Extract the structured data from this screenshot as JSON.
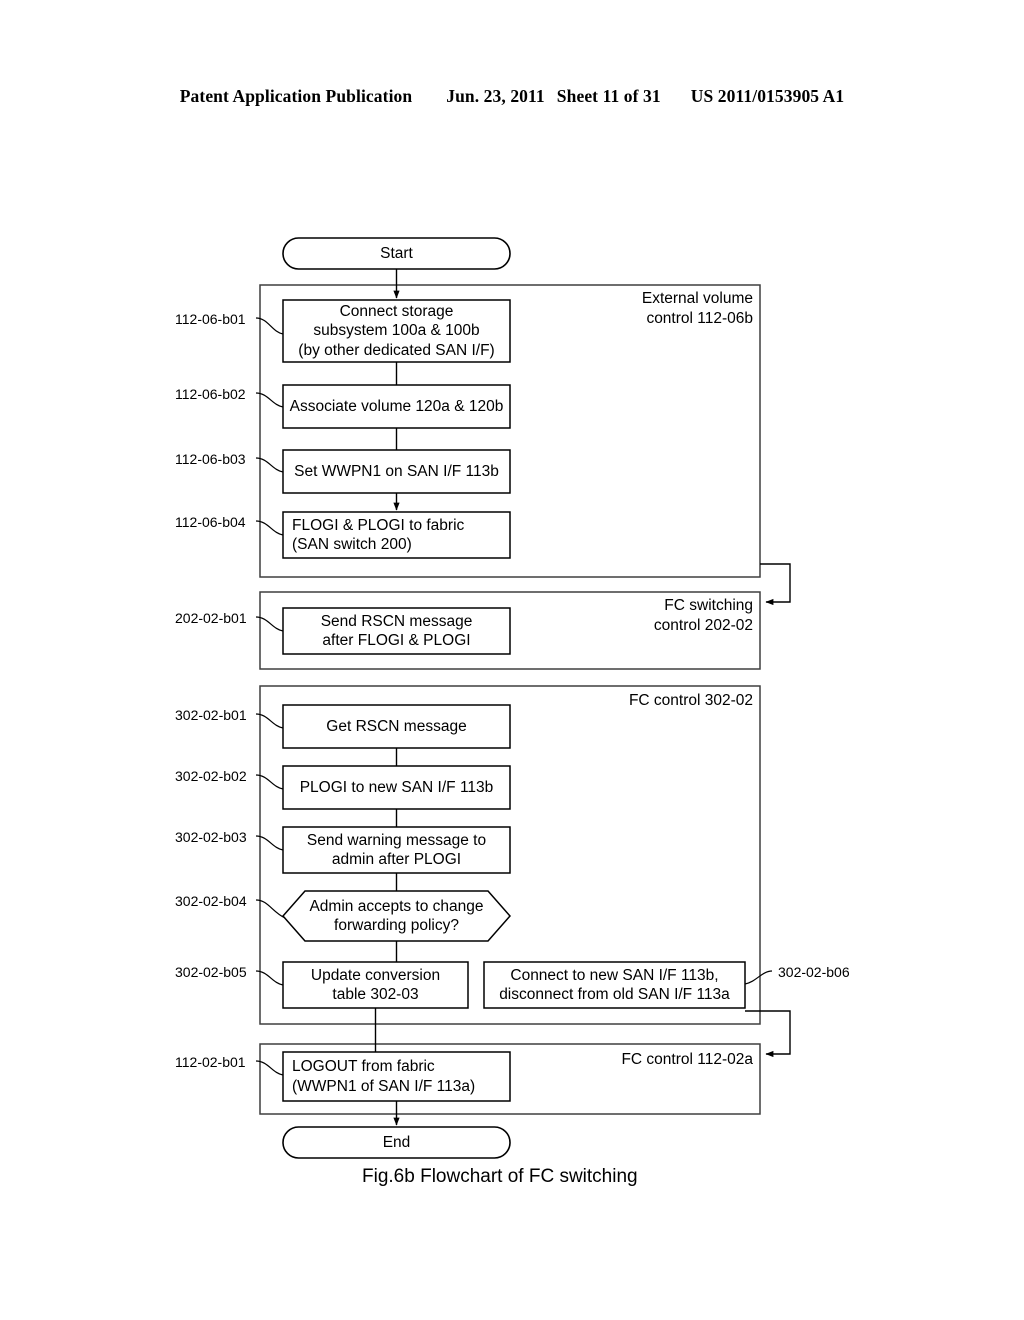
{
  "header": {
    "publication": "Patent Application Publication",
    "date": "Jun. 23, 2011",
    "sheet": "Sheet 11 of 31",
    "patent_number": "US 2011/0153905 A1"
  },
  "figure": {
    "caption": "Fig.6b Flowchart of FC switching",
    "terminators": {
      "start": "Start",
      "end": "End"
    },
    "groups": [
      {
        "id": "external-volume-control",
        "label": "External volume\ncontrol 112-06b"
      },
      {
        "id": "fc-switching-control",
        "label": "FC switching\ncontrol 202-02"
      },
      {
        "id": "fc-control-302-02",
        "label": "FC control 302-02"
      },
      {
        "id": "fc-control-112-02a",
        "label": "FC control 112-02a"
      }
    ],
    "steps": [
      {
        "ref": "112-06-b01",
        "text": "Connect storage\nsubsystem 100a & 100b\n(by other dedicated SAN I/F)",
        "shape": "process"
      },
      {
        "ref": "112-06-b02",
        "text": "Associate volume 120a & 120b",
        "shape": "process"
      },
      {
        "ref": "112-06-b03",
        "text": "Set WWPN1 on SAN I/F 113b",
        "shape": "process"
      },
      {
        "ref": "112-06-b04",
        "text": "FLOGI & PLOGI to fabric\n(SAN switch 200)",
        "shape": "process"
      },
      {
        "ref": "202-02-b01",
        "text": "Send RSCN message\nafter FLOGI & PLOGI",
        "shape": "process"
      },
      {
        "ref": "302-02-b01",
        "text": "Get RSCN message",
        "shape": "process"
      },
      {
        "ref": "302-02-b02",
        "text": "PLOGI to new SAN I/F 113b",
        "shape": "process"
      },
      {
        "ref": "302-02-b03",
        "text": "Send warning message to\nadmin after PLOGI",
        "shape": "process"
      },
      {
        "ref": "302-02-b04",
        "text": "Admin accepts to change\nforwarding policy?",
        "shape": "decision"
      },
      {
        "ref": "302-02-b05",
        "text": "Update conversion\ntable 302-03",
        "shape": "process"
      },
      {
        "ref": "302-02-b06",
        "text": "Connect to new SAN I/F 113b,\ndisconnect from old SAN I/F 113a",
        "shape": "process"
      },
      {
        "ref": "112-02-b01",
        "text": "LOGOUT from fabric\n(WWPN1 of SAN I/F 113a)",
        "shape": "process"
      }
    ]
  },
  "colors": {
    "ink": "#000000",
    "paper": "#ffffff",
    "group_border": "#5a5a5a"
  }
}
